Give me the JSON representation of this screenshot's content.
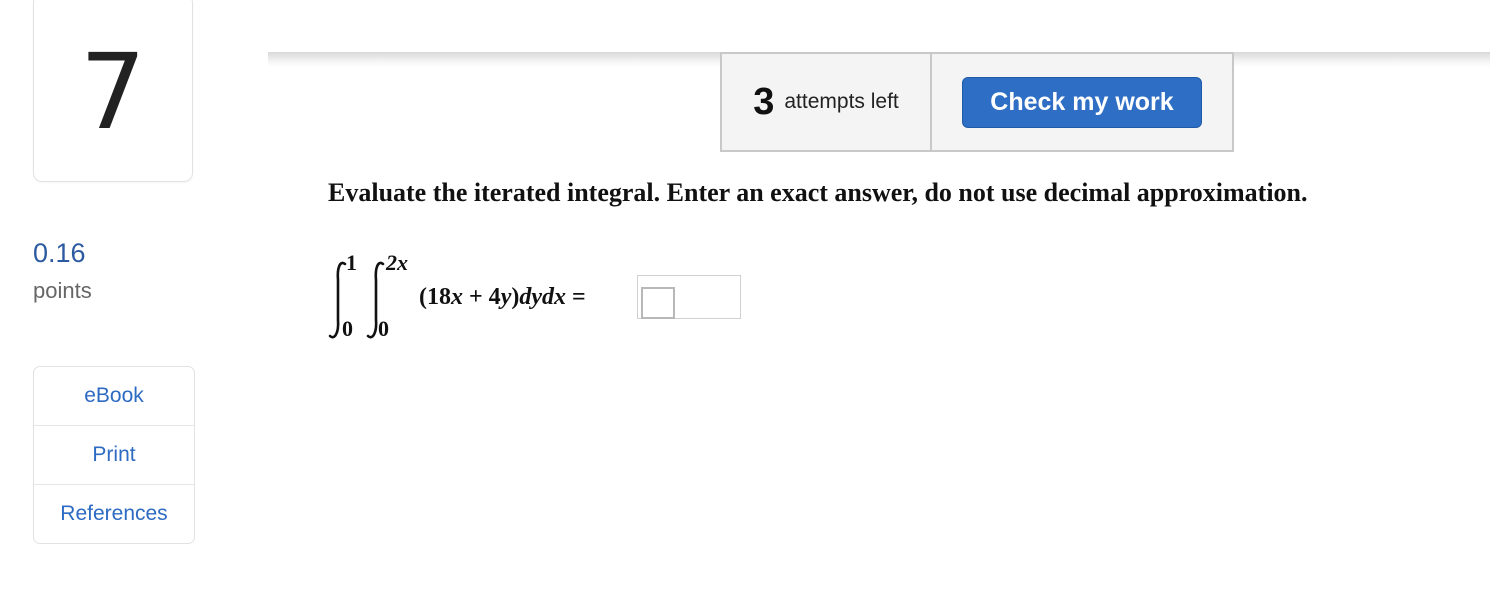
{
  "question": {
    "number": "7",
    "points_value": "0.16",
    "points_label": "points"
  },
  "sidebar": {
    "links": [
      {
        "label": "eBook"
      },
      {
        "label": "Print"
      },
      {
        "label": "References"
      }
    ]
  },
  "toolbar": {
    "attempts_count": "3",
    "attempts_text": "attempts left",
    "check_label": "Check my work"
  },
  "problem": {
    "prompt": "Evaluate the iterated integral. Enter an exact answer, do not use decimal approximation.",
    "outer_upper": "1",
    "outer_lower": "0",
    "inner_upper": "2x",
    "inner_lower": "0",
    "integrand_open": "(18",
    "integrand_x": "x",
    "integrand_plus": " + 4",
    "integrand_y": "y",
    "integrand_close": ")",
    "integrand_diff": "dydx",
    "equals": " =",
    "answer_value": ""
  },
  "colors": {
    "accent": "#2e6ec4",
    "link": "#2d6bc2",
    "points": "#2c5aa0"
  }
}
